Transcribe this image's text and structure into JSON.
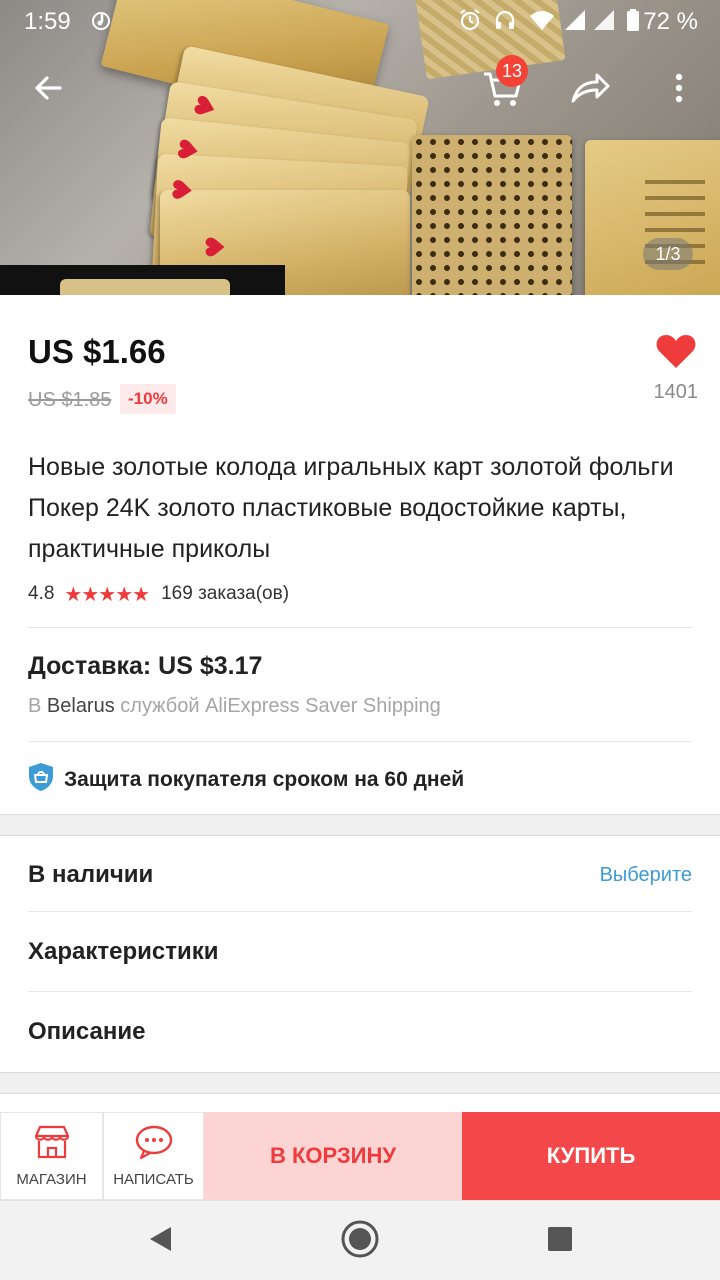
{
  "status_bar": {
    "time": "1:59",
    "battery_percent": "72 %",
    "icons": [
      "music-note-icon",
      "alarm-icon",
      "headset-icon",
      "wifi-icon",
      "signal-icon",
      "signal-icon",
      "battery-icon"
    ]
  },
  "top_bar": {
    "back_icon": "arrow-left-icon",
    "cart_icon": "cart-icon",
    "cart_badge": "13",
    "share_icon": "share-icon",
    "more_icon": "more-vertical-icon"
  },
  "gallery": {
    "pager": "1/3"
  },
  "product": {
    "price": "US $1.66",
    "old_price": "US $1.85",
    "discount": "-10%",
    "favorites_count": "1401",
    "title": "Новые золотые колода игральных карт золотой фольги Покер 24K золото пластиковые водостойкие карты, практичные приколы",
    "rating": "4.8",
    "rating_stars": 5,
    "orders": "169 заказа(ов)"
  },
  "shipping": {
    "title": "Доставка: US $3.17",
    "prefix": "В",
    "country": "Belarus",
    "suffix": "службой AliExpress Saver Shipping"
  },
  "protection": {
    "text": "Защита покупателя сроком на 60 дней"
  },
  "sections": {
    "availability": "В наличии",
    "availability_action": "Выберите",
    "specs": "Характеристики",
    "description": "Описание"
  },
  "action_bar": {
    "store_label": "МАГАЗИН",
    "message_label": "НАПИСАТЬ",
    "add_to_cart": "В КОРЗИНУ",
    "buy": "КУПИТЬ"
  },
  "colors": {
    "accent_red": "#f4474a",
    "light_red": "#fdd4d4",
    "link_blue": "#3d9bd6"
  }
}
